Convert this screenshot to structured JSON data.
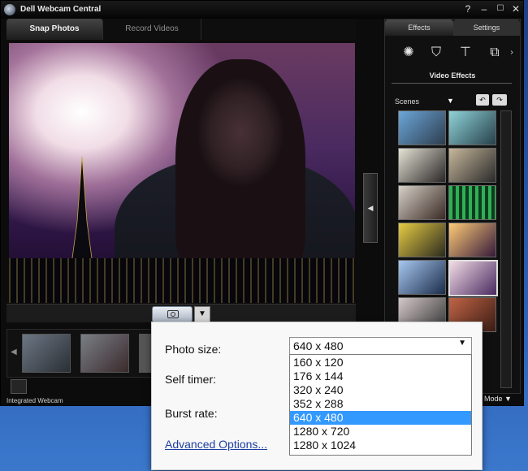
{
  "window": {
    "title": "Dell Webcam Central"
  },
  "left_tabs": [
    {
      "label": "Snap Photos",
      "active": true
    },
    {
      "label": "Record Videos",
      "active": false
    }
  ],
  "status": {
    "camera_name": "Integrated Webcam"
  },
  "right_tabs": [
    {
      "label": "Effects",
      "active": true
    },
    {
      "label": "Settings",
      "active": false
    }
  ],
  "effects": {
    "section_label": "Video Effects",
    "category": "Scenes",
    "icon_names": [
      "effects-film-icon",
      "avatar-mask-icon",
      "presentation-board-icon",
      "frames-icon"
    ]
  },
  "mode_label": "Mode",
  "popup": {
    "photo_size_label": "Photo size:",
    "photo_size_value": "640 x 480",
    "self_timer_label": "Self timer:",
    "burst_rate_label": "Burst rate:",
    "advanced_link": "Advanced Options...",
    "options": [
      "160 x 120",
      "176 x 144",
      "320 x 240",
      "352 x 288",
      "640 x 480",
      "1280 x 720",
      "1280 x 1024"
    ],
    "selected_option": "640 x 480"
  },
  "colors": {
    "window_bg": "#0c0c0c",
    "selection": "#3399ff",
    "link": "#1d3ea0"
  }
}
